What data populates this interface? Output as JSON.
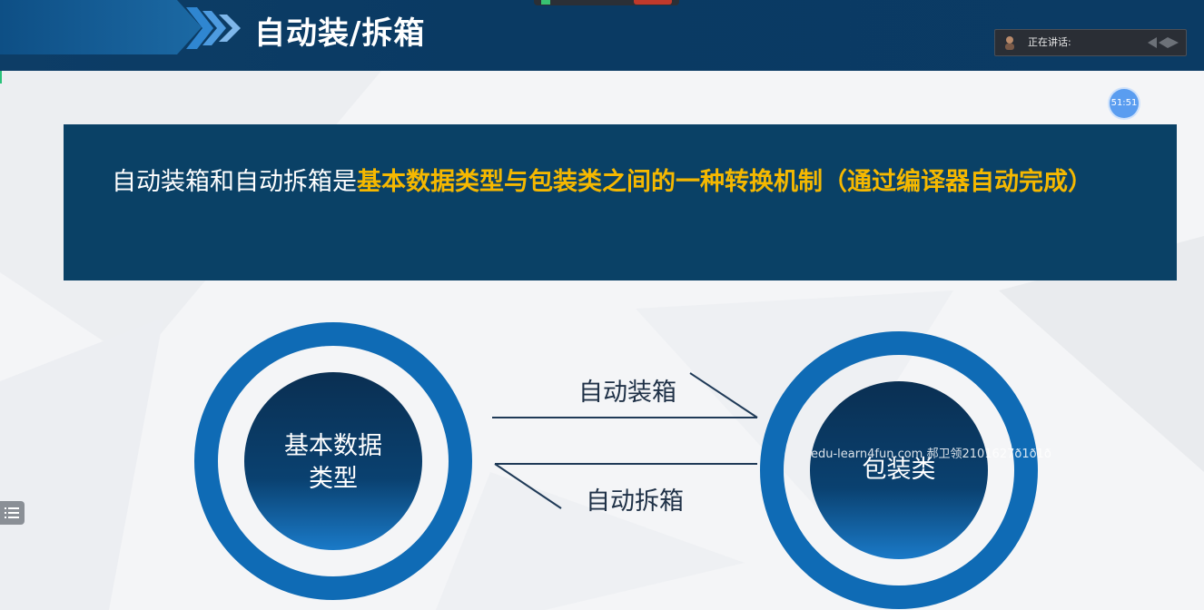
{
  "slide": {
    "title": "自动装/拆箱",
    "definition_normal": "自动装箱和自动拆箱是",
    "definition_highlight": "基本数据类型与包装类之间的一种转换机制（通过编译器自动完成）",
    "left_circle_line1": "基本数据",
    "left_circle_line2": "类型",
    "right_circle_label": "包装类",
    "top_arrow_label": "自动装箱",
    "bottom_arrow_label": "自动拆箱"
  },
  "overlay": {
    "speaking_label": "正在讲话:",
    "timer": "51:51",
    "watermark": "edu-learn4fun.com 郝卫领2101627ð1ð1ð"
  },
  "colors": {
    "header": "#0a3a63",
    "banner": "#0a4166",
    "highlight": "#f5b800",
    "ring": "#0f6bb5",
    "circle_fill": "#0a3d66"
  }
}
